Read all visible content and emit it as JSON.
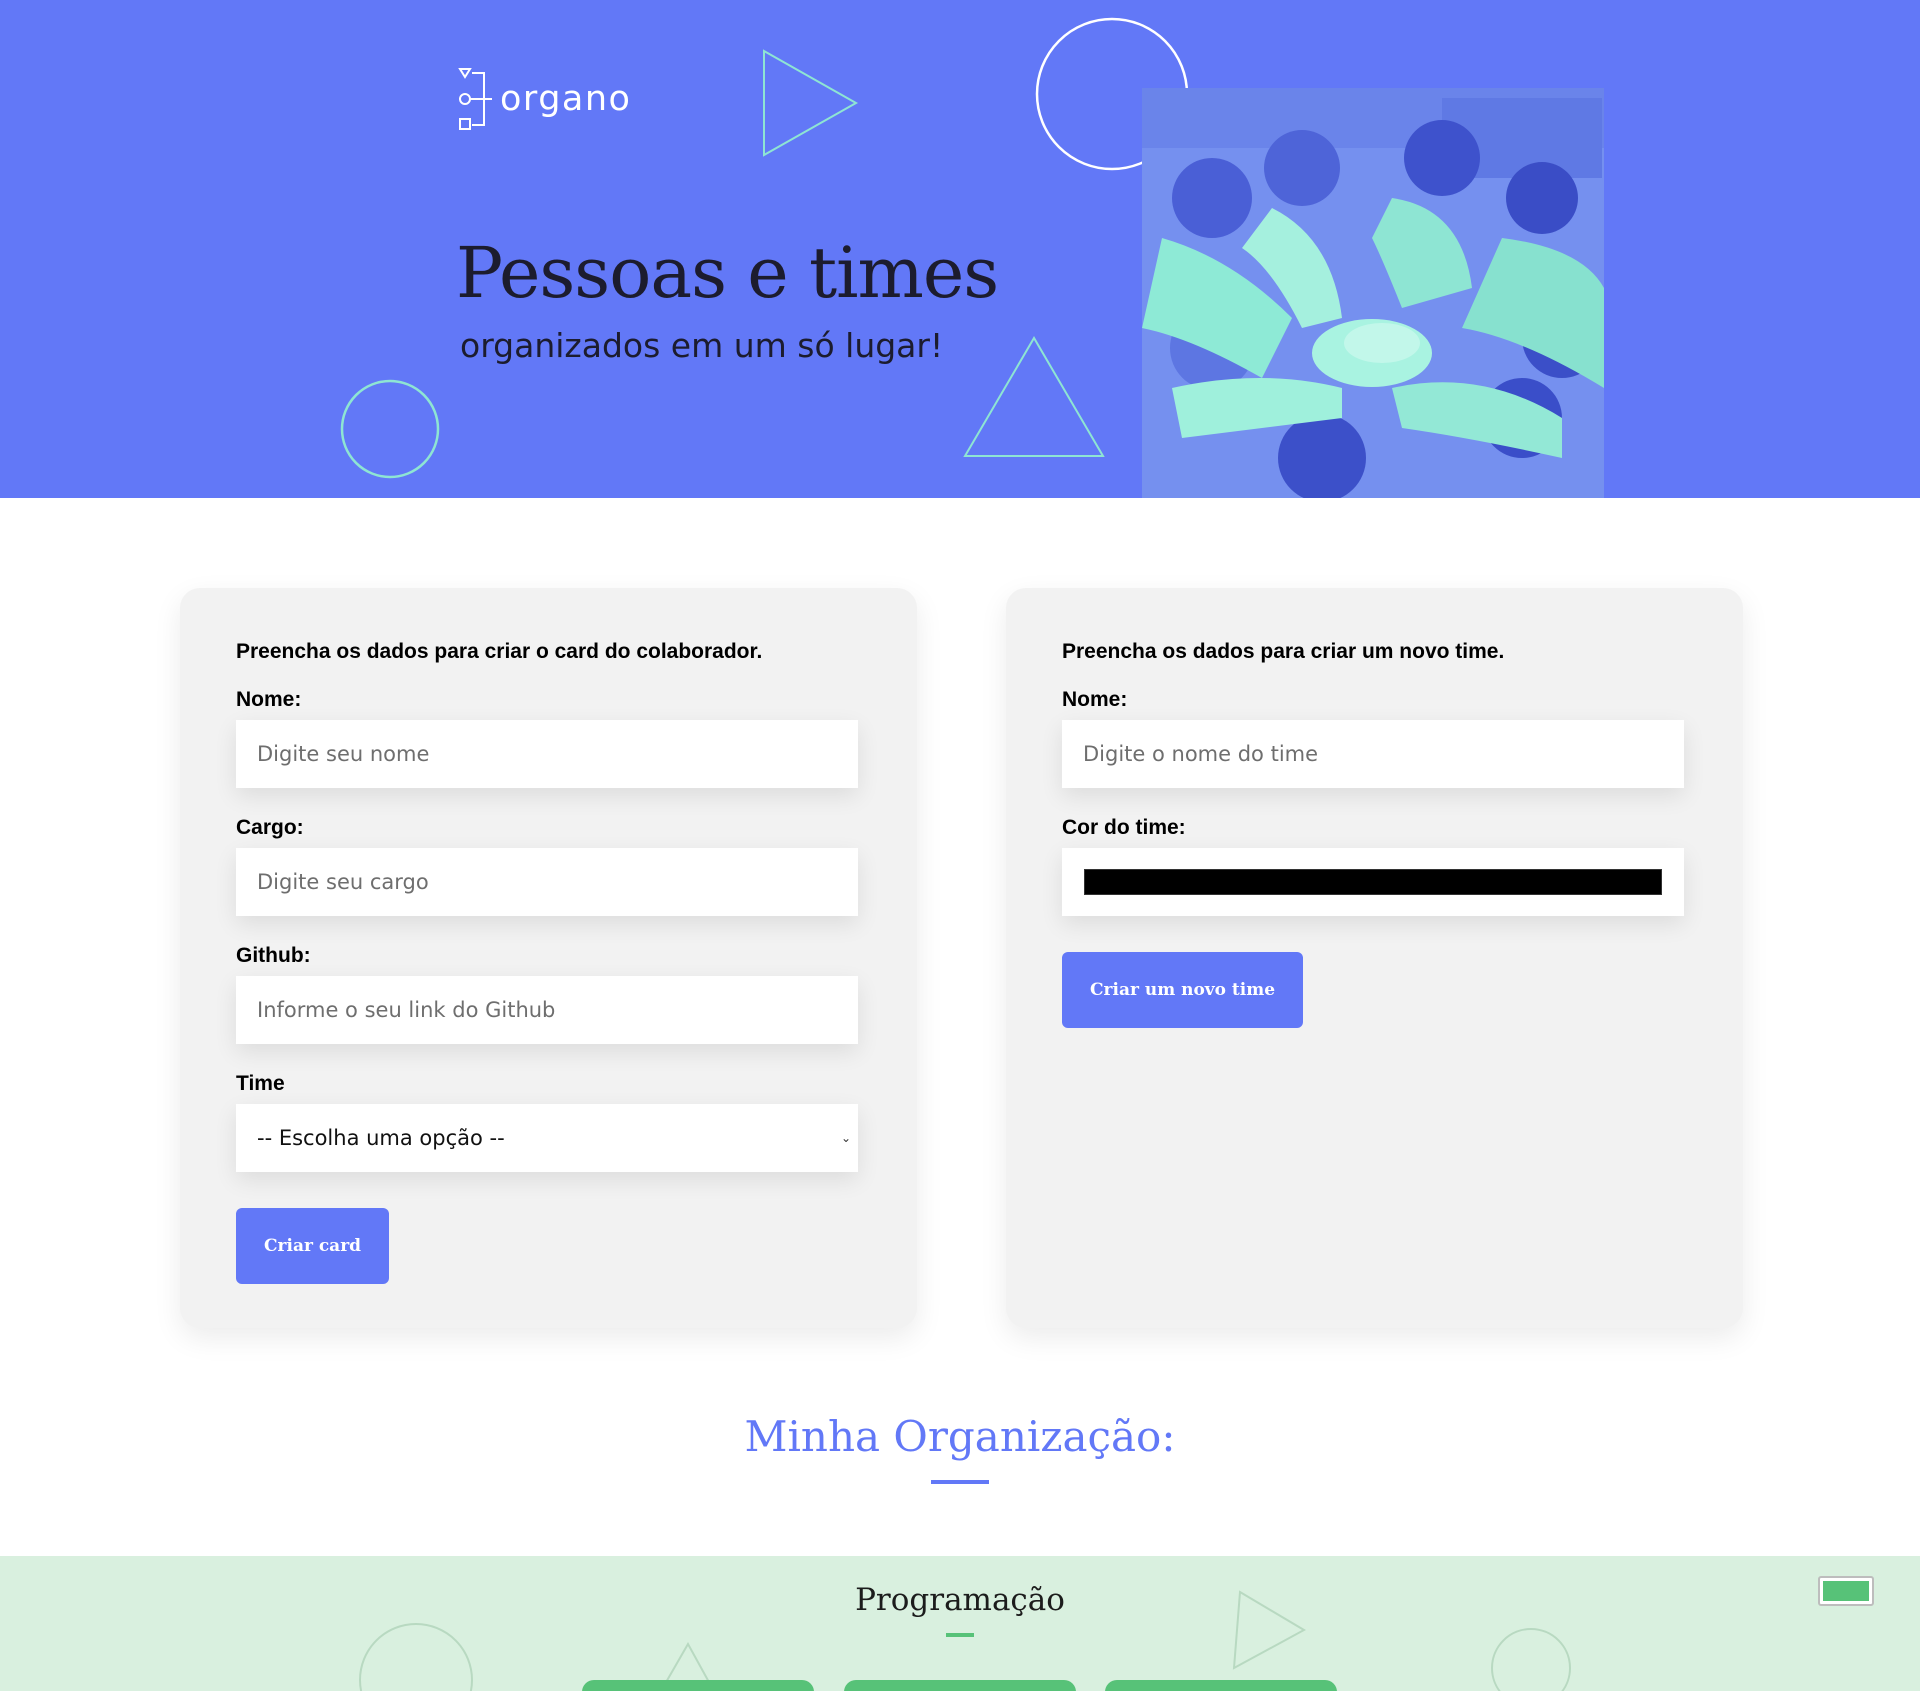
{
  "banner": {
    "logo_text": "organo",
    "title": "Pessoas e times",
    "subtitle": "organizados em um só lugar!",
    "background_color": "#6278f7",
    "photo_description": "team-hands-stacked-photo"
  },
  "collaborator_form": {
    "heading": "Preencha os dados para criar o card do colaborador.",
    "name_label": "Nome:",
    "name_placeholder": "Digite seu nome",
    "role_label": "Cargo:",
    "role_placeholder": "Digite seu cargo",
    "github_label": "Github:",
    "github_placeholder": "Informe o seu link do Github",
    "team_label": "Time",
    "team_selected": "-- Escolha uma opção --",
    "submit_label": "Criar card"
  },
  "team_form": {
    "heading": "Preencha os dados para criar um novo time.",
    "name_label": "Nome:",
    "name_placeholder": "Digite o nome do time",
    "color_label": "Cor do time:",
    "color_value": "#000000",
    "submit_label": "Criar um novo time"
  },
  "organization": {
    "title": "Minha Organização:",
    "accent_color": "#6278f7"
  },
  "teams": [
    {
      "name": "Programação",
      "primary_color": "#57c278",
      "secondary_color": "#d9f0df"
    }
  ]
}
